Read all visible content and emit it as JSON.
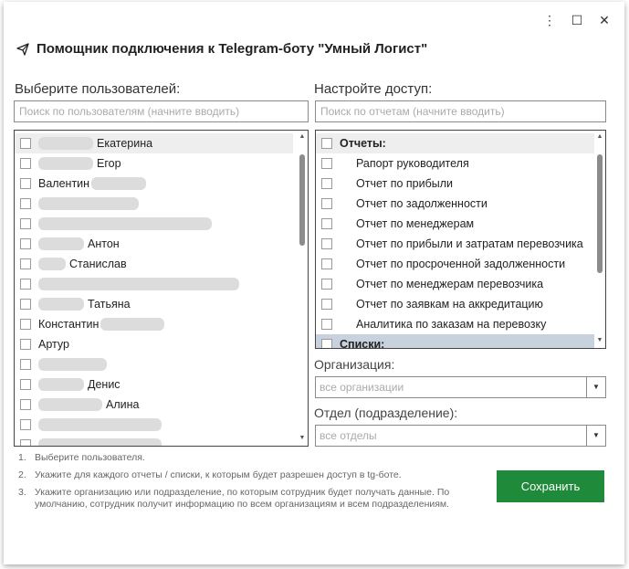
{
  "window": {
    "title": "Помощник подключения к Telegram-боту \"Умный Логист\"",
    "controls": {
      "menu": "⋮",
      "maximize": "☐",
      "close": "✕"
    }
  },
  "users": {
    "label": "Выберите пользователей:",
    "search_placeholder": "Поиск по пользователям (начните вводить)",
    "items": [
      {
        "name": "Екатерина"
      },
      {
        "name": "Егор"
      },
      {
        "name": "Валентин"
      },
      {
        "name": ""
      },
      {
        "name": ""
      },
      {
        "name": "Антон"
      },
      {
        "name": "Станислав"
      },
      {
        "name": ""
      },
      {
        "name": "Татьяна"
      },
      {
        "name": "Константин"
      },
      {
        "name": "Артур"
      },
      {
        "name": ""
      },
      {
        "name": "Денис"
      },
      {
        "name": "Алина"
      },
      {
        "name": ""
      },
      {
        "name": ""
      }
    ]
  },
  "access": {
    "label": "Настройте доступ:",
    "search_placeholder": "Поиск по отчетам (начните вводить)",
    "groups": [
      {
        "name": "Отчеты:",
        "items": [
          "Рапорт руководителя",
          "Отчет по прибыли",
          "Отчет по задолженности",
          "Отчет по менеджерам",
          "Отчет по прибыли и затратам перевозчика",
          "Отчет по просроченной задолженности",
          "Отчет по менеджерам перевозчика",
          "Отчет по заявкам на аккредитацию",
          "Аналитика по заказам на перевозку"
        ]
      },
      {
        "name": "Списки:",
        "items": []
      }
    ]
  },
  "organization": {
    "label": "Организация:",
    "value": "все организации"
  },
  "department": {
    "label": "Отдел (подразделение):",
    "value": "все отделы"
  },
  "notes": [
    {
      "num": "1.",
      "text": "Выберите пользователя."
    },
    {
      "num": "2.",
      "text": "Укажите для каждого отчеты / списки, к которым будет разрешен доступ в tg-боте."
    },
    {
      "num": "3.",
      "text": "Укажите организацию или подразделение, по которым сотрудник будет получать данные. По умолчанию, сотрудник получит информацию по всем организациям и всем подразделениям."
    }
  ],
  "save_button": "Сохранить",
  "colors": {
    "accent": "#1e8a3a",
    "selected_row": "#c8d2de"
  }
}
